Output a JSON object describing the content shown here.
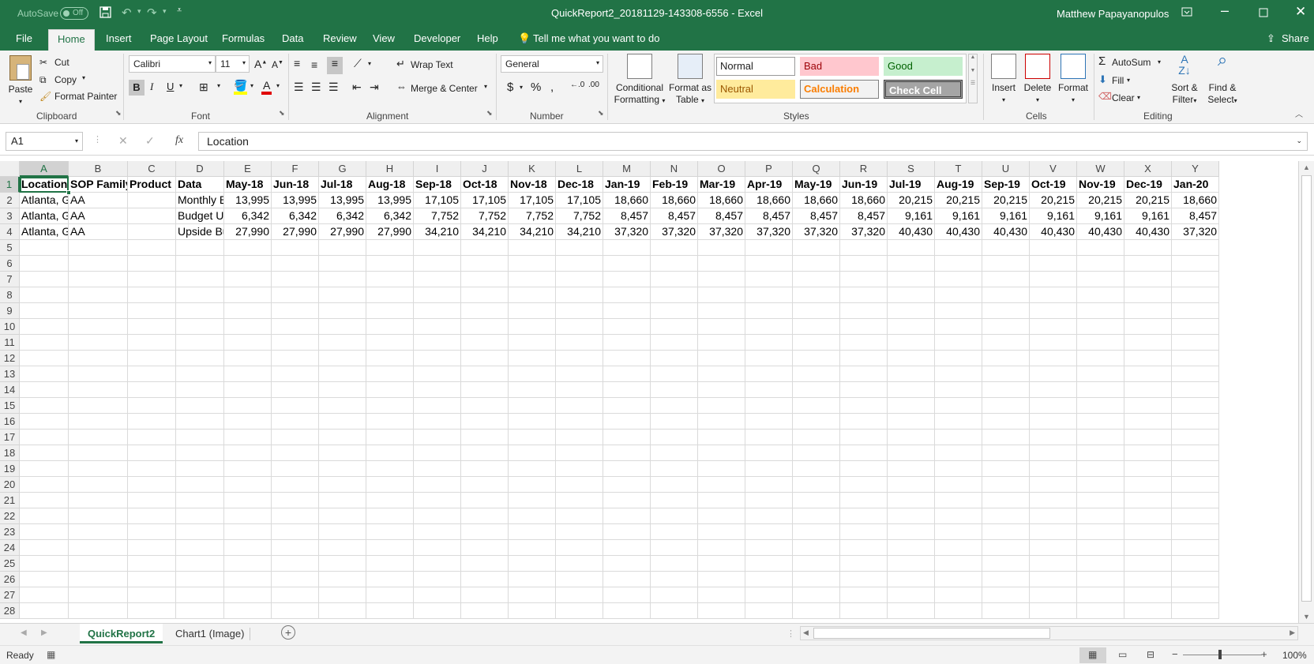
{
  "title_bar": {
    "autosave_label": "AutoSave",
    "autosave_state": "Off",
    "filename": "QuickReport2_20181129-143308-6556",
    "separator": "-",
    "app_name": "Excel",
    "user": "Matthew Papayanopulos"
  },
  "tabs": [
    "File",
    "Home",
    "Insert",
    "Page Layout",
    "Formulas",
    "Data",
    "Review",
    "View",
    "Developer",
    "Help"
  ],
  "tell_me": "Tell me what you want to do",
  "share": "Share",
  "clipboard": {
    "paste": "Paste",
    "cut": "Cut",
    "copy": "Copy",
    "format_painter": "Format Painter",
    "label": "Clipboard"
  },
  "font": {
    "name": "Calibri",
    "size": "11",
    "label": "Font"
  },
  "alignment": {
    "wrap_text": "Wrap Text",
    "merge_center": "Merge & Center",
    "label": "Alignment"
  },
  "number": {
    "format": "General",
    "label": "Number"
  },
  "styles_group": {
    "conditional": "Conditional",
    "formatting": "Formatting",
    "format_as": "Format as",
    "table": "Table",
    "label": "Styles"
  },
  "styles": {
    "normal": "Normal",
    "bad": "Bad",
    "good": "Good",
    "neutral": "Neutral",
    "calculation": "Calculation",
    "check_cell": "Check Cell"
  },
  "cells": {
    "insert": "Insert",
    "delete": "Delete",
    "format": "Format",
    "label": "Cells"
  },
  "editing": {
    "autosum": "AutoSum",
    "fill": "Fill",
    "clear": "Clear",
    "sort": "Sort &",
    "filter": "Filter",
    "find": "Find &",
    "select": "Select",
    "label": "Editing"
  },
  "formula": {
    "name_box": "A1",
    "fx": "fx",
    "content": "Location"
  },
  "columns": [
    "A",
    "B",
    "C",
    "D",
    "E",
    "F",
    "G",
    "H",
    "I",
    "J",
    "K",
    "L",
    "M",
    "N",
    "O",
    "P",
    "Q",
    "R",
    "S",
    "T",
    "U",
    "V",
    "W",
    "X",
    "Y"
  ],
  "rows": [
    "1",
    "2",
    "3",
    "4",
    "5",
    "6",
    "7",
    "8",
    "9",
    "10",
    "11",
    "12",
    "13",
    "14",
    "15",
    "16",
    "17",
    "18",
    "19",
    "20",
    "21",
    "22",
    "23",
    "24",
    "25",
    "26",
    "27",
    "28"
  ],
  "header_row": [
    "Location",
    "SOP Family",
    "Product",
    "Data",
    "May-18",
    "Jun-18",
    "Jul-18",
    "Aug-18",
    "Sep-18",
    "Oct-18",
    "Nov-18",
    "Dec-18",
    "Jan-19",
    "Feb-19",
    "Mar-19",
    "Apr-19",
    "May-19",
    "Jun-19",
    "Jul-19",
    "Aug-19",
    "Sep-19",
    "Oct-19",
    "Nov-19",
    "Dec-19",
    "Jan-20"
  ],
  "data_rows": [
    [
      "Atlanta, G",
      "AA",
      "",
      "Monthly B",
      "13,995",
      "13,995",
      "13,995",
      "13,995",
      "17,105",
      "17,105",
      "17,105",
      "17,105",
      "18,660",
      "18,660",
      "18,660",
      "18,660",
      "18,660",
      "18,660",
      "20,215",
      "20,215",
      "20,215",
      "20,215",
      "20,215",
      "20,215",
      "18,660"
    ],
    [
      "Atlanta, G",
      "AA",
      "",
      "Budget Ur",
      "6,342",
      "6,342",
      "6,342",
      "6,342",
      "7,752",
      "7,752",
      "7,752",
      "7,752",
      "8,457",
      "8,457",
      "8,457",
      "8,457",
      "8,457",
      "8,457",
      "9,161",
      "9,161",
      "9,161",
      "9,161",
      "9,161",
      "9,161",
      "8,457"
    ],
    [
      "Atlanta, G",
      "AA",
      "",
      "Upside Bu",
      "27,990",
      "27,990",
      "27,990",
      "27,990",
      "34,210",
      "34,210",
      "34,210",
      "34,210",
      "37,320",
      "37,320",
      "37,320",
      "37,320",
      "37,320",
      "37,320",
      "40,430",
      "40,430",
      "40,430",
      "40,430",
      "40,430",
      "40,430",
      "37,320"
    ]
  ],
  "sheets": [
    "QuickReport2",
    "Chart1 (Image)"
  ],
  "status": {
    "ready": "Ready",
    "zoom": "100%"
  }
}
